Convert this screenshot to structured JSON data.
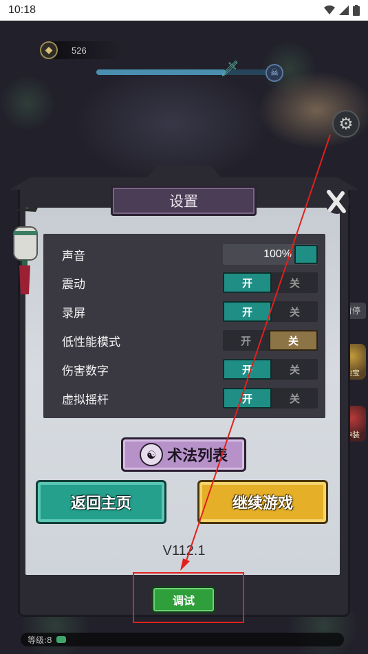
{
  "status_bar": {
    "time": "10:18"
  },
  "hud": {
    "coins": "526",
    "progress_fraction": 0.75,
    "pause_label": "暂停",
    "side_items": [
      "地宝",
      "神装"
    ],
    "level_label": "等级:8"
  },
  "settings": {
    "title": "设置",
    "rows": [
      {
        "label": "声音",
        "type": "volume",
        "value": "100%"
      },
      {
        "label": "震动",
        "type": "toggle",
        "on": "开",
        "off": "关",
        "state": "on"
      },
      {
        "label": "录屏",
        "type": "toggle",
        "on": "开",
        "off": "关",
        "state": "on"
      },
      {
        "label": "低性能模式",
        "type": "toggle",
        "on": "开",
        "off": "关",
        "state": "off"
      },
      {
        "label": "伤害数字",
        "type": "toggle",
        "on": "开",
        "off": "关",
        "state": "on"
      },
      {
        "label": "虚拟摇杆",
        "type": "toggle",
        "on": "开",
        "off": "关",
        "state": "on"
      }
    ],
    "spell_list_label": "术法列表",
    "home_label": "返回主页",
    "continue_label": "继续游戏",
    "version": "V112.1",
    "debug_label": "调试"
  },
  "icons": {
    "coin": "coin-icon",
    "gear": "gear-icon",
    "close": "close-icon",
    "sword": "sword-icon",
    "boss": "boss-icon"
  },
  "colors": {
    "toggle_on": "#1f8f86",
    "toggle_off": "#8d7446",
    "home_button": "#24a08c",
    "continue_button": "#e5b028",
    "debug_button": "#2e9f3a",
    "spell_button": "#b792c9",
    "annotation": "#e0201c"
  }
}
